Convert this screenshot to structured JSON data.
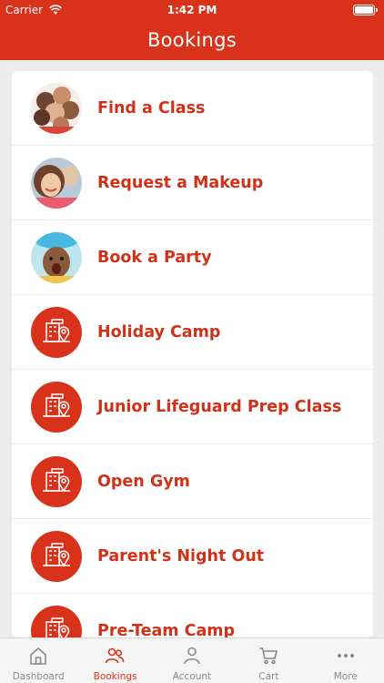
{
  "status_bar": {
    "carrier": "Carrier",
    "time": "1:42 PM"
  },
  "header": {
    "title": "Bookings"
  },
  "menu": {
    "items": [
      {
        "label": "Find a Class",
        "image": "group-of-kids-photo"
      },
      {
        "label": "Request a Makeup",
        "image": "smiling-girl-photo"
      },
      {
        "label": "Book a Party",
        "image": "excited-child-photo"
      },
      {
        "label": "Holiday Camp",
        "icon": "building-location-icon"
      },
      {
        "label": "Junior Lifeguard Prep Class",
        "icon": "building-location-icon"
      },
      {
        "label": "Open Gym",
        "icon": "building-location-icon"
      },
      {
        "label": "Parent's Night Out",
        "icon": "building-location-icon"
      },
      {
        "label": "Pre-Team Camp",
        "icon": "building-location-icon"
      }
    ]
  },
  "tabbar": {
    "tabs": [
      {
        "label": "Dashboard",
        "icon": "home-icon"
      },
      {
        "label": "Bookings",
        "icon": "people-icon",
        "active": true
      },
      {
        "label": "Account",
        "icon": "person-icon"
      },
      {
        "label": "Cart",
        "icon": "cart-icon"
      },
      {
        "label": "More",
        "icon": "more-dots-icon"
      }
    ]
  },
  "colors": {
    "brand": "#d9321a",
    "label": "#cf3218",
    "inactive": "#8a8a8a",
    "background": "#ececec"
  }
}
